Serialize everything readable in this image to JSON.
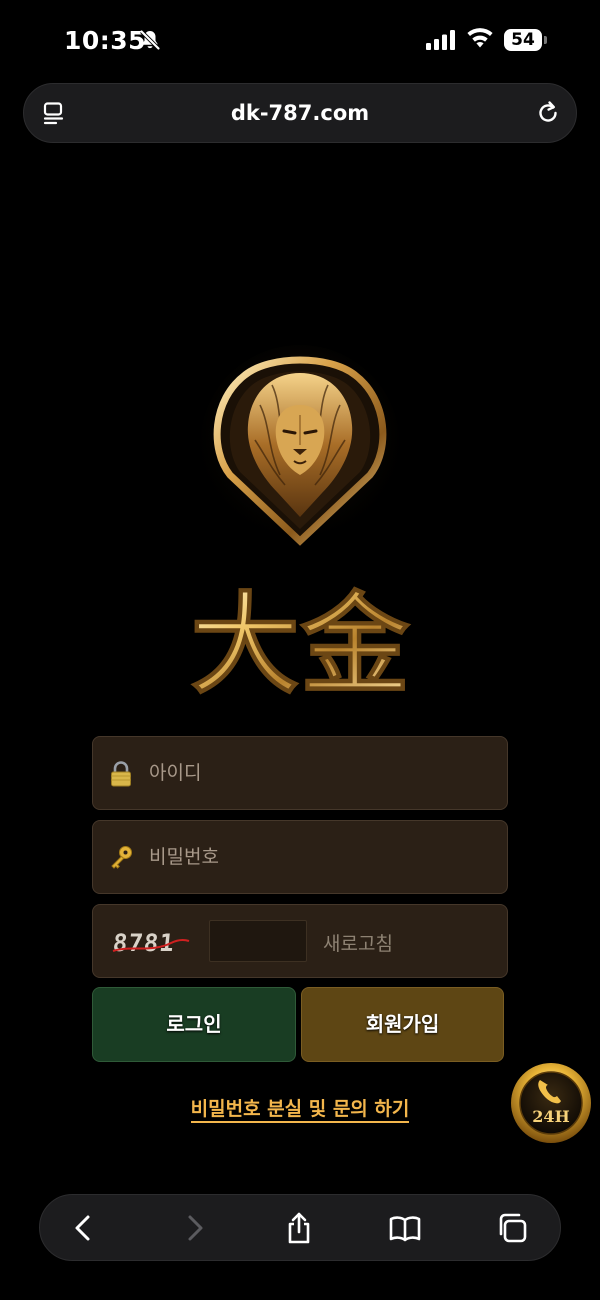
{
  "status_bar": {
    "time": "10:35",
    "battery": "54",
    "icons": [
      "bell-slash-icon",
      "cellular-signal-icon",
      "wifi-icon",
      "battery-icon"
    ]
  },
  "browser": {
    "url": "dk-787.com",
    "icons": [
      "reader-mode-icon",
      "reload-icon"
    ]
  },
  "brand": {
    "logo_text": "大金",
    "emblem": "lion-head-emblem"
  },
  "login_form": {
    "username_placeholder": "아이디",
    "password_placeholder": "비밀번호",
    "captcha_code": "8781",
    "captcha_value": "",
    "refresh_label": "새로고침",
    "login_label": "로그인",
    "signup_label": "회원가입",
    "help_link": "비밀번호 분실 및 문의 하기"
  },
  "support_badge": {
    "label": "24H",
    "icon": "phone-icon"
  },
  "toolbar": {
    "icons": [
      "back-icon",
      "forward-icon",
      "share-icon",
      "bookmarks-icon",
      "tabs-icon"
    ]
  },
  "colors": {
    "background": "#000000",
    "field_bg": "#2b2016",
    "login_bg": "#193d23",
    "signup_bg": "#5e4614",
    "link_gold": "#f3b64c"
  }
}
